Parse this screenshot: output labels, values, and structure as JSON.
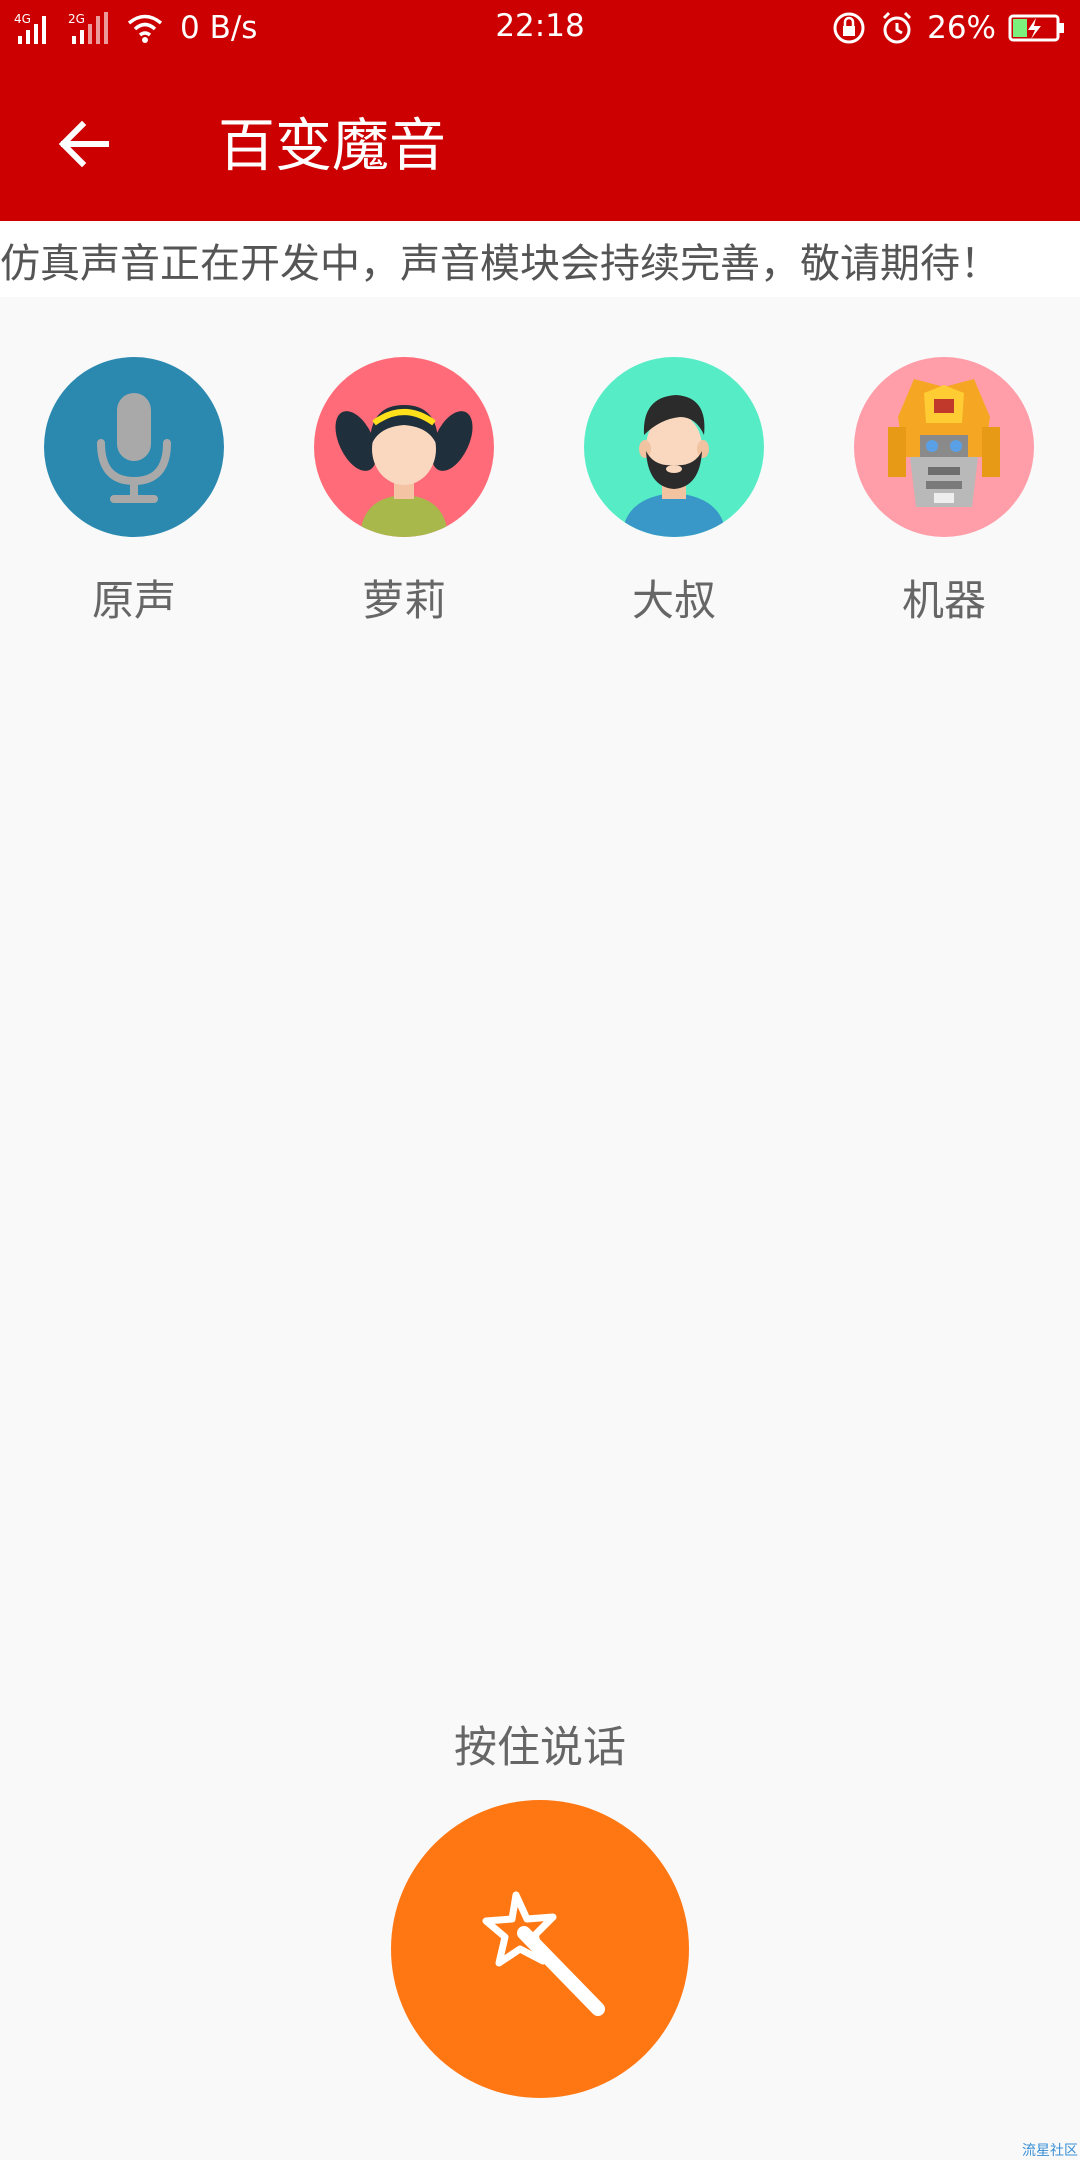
{
  "status_bar": {
    "signal_1": "4G",
    "signal_2": "2G",
    "net_speed": "0 B/s",
    "time": "22:18",
    "battery": "26%"
  },
  "app_bar": {
    "title": "百变魔音"
  },
  "notice": "仿真声音正在开发中，声音模块会持续完善，敬请期待！",
  "voices": [
    {
      "label": "原声",
      "icon": "microphone-icon",
      "color": "#2b89b0"
    },
    {
      "label": "萝莉",
      "icon": "girl-avatar-icon",
      "color": "#ff6b78"
    },
    {
      "label": "大叔",
      "icon": "bearded-man-avatar-icon",
      "color": "#55ecc6"
    },
    {
      "label": "机器",
      "icon": "robot-avatar-icon",
      "color": "#ff9da8"
    }
  ],
  "hold_to_talk": "按住说话",
  "magic_button": {
    "icon": "magic-wand-icon",
    "color": "#ff7713"
  },
  "watermark": "流星社区",
  "colors": {
    "primary": "#cc0000",
    "background": "#f9f9f9"
  }
}
